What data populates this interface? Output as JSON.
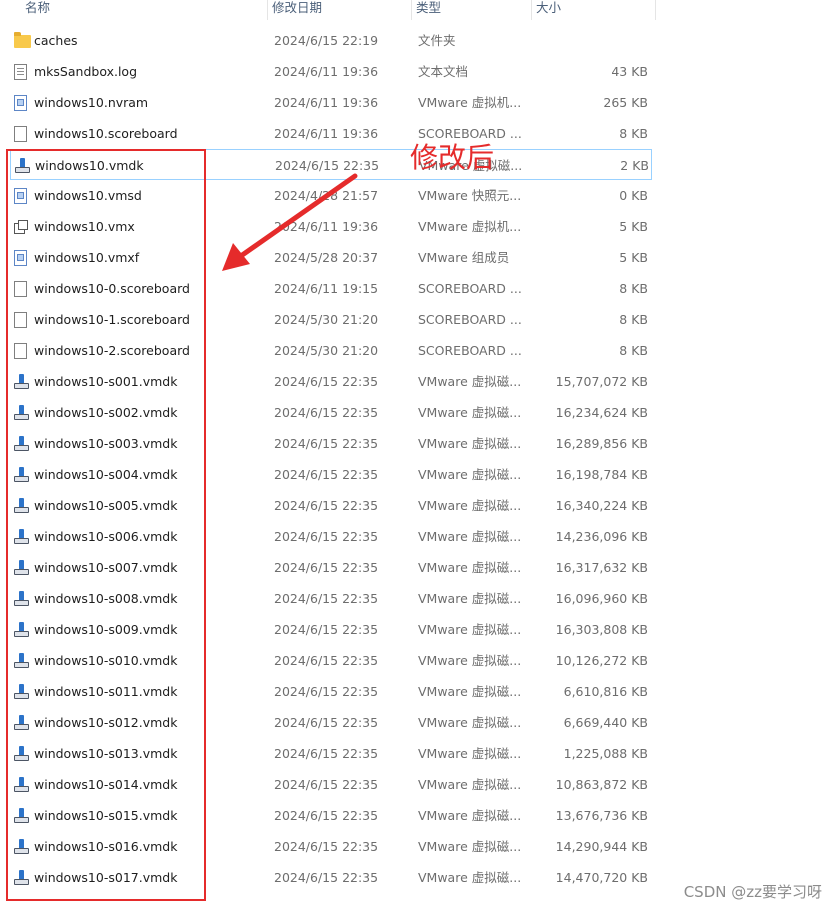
{
  "columns": {
    "name": "名称",
    "date": "修改日期",
    "type": "类型",
    "size": "大小"
  },
  "files": [
    {
      "name": "caches",
      "date": "2024/6/15 22:19",
      "type": "文件夹",
      "size": "",
      "icon": "folder-icon"
    },
    {
      "name": "mksSandbox.log",
      "date": "2024/6/11 19:36",
      "type": "文本文档",
      "size": "43 KB",
      "icon": "text-file-icon"
    },
    {
      "name": "windows10.nvram",
      "date": "2024/6/11 19:36",
      "type": "VMware 虚拟机...",
      "size": "265 KB",
      "icon": "nvram-file-icon"
    },
    {
      "name": "windows10.scoreboard",
      "date": "2024/6/11 19:36",
      "type": "SCOREBOARD ...",
      "size": "8 KB",
      "icon": "blank-file-icon"
    },
    {
      "name": "windows10.vmdk",
      "date": "2024/6/15 22:35",
      "type": "VMware 虚拟磁...",
      "size": "2 KB",
      "icon": "disk-icon",
      "selected": true
    },
    {
      "name": "windows10.vmsd",
      "date": "2024/4/28 21:57",
      "type": "VMware 快照元...",
      "size": "0 KB",
      "icon": "snapshot-file-icon"
    },
    {
      "name": "windows10.vmx",
      "date": "2024/6/11 19:36",
      "type": "VMware 虚拟机...",
      "size": "5 KB",
      "icon": "vmx-icon"
    },
    {
      "name": "windows10.vmxf",
      "date": "2024/5/28 20:37",
      "type": "VMware 组成员",
      "size": "5 KB",
      "icon": "team-file-icon"
    },
    {
      "name": "windows10-0.scoreboard",
      "date": "2024/6/11 19:15",
      "type": "SCOREBOARD ...",
      "size": "8 KB",
      "icon": "blank-file-icon"
    },
    {
      "name": "windows10-1.scoreboard",
      "date": "2024/5/30 21:20",
      "type": "SCOREBOARD ...",
      "size": "8 KB",
      "icon": "blank-file-icon"
    },
    {
      "name": "windows10-2.scoreboard",
      "date": "2024/5/30 21:20",
      "type": "SCOREBOARD ...",
      "size": "8 KB",
      "icon": "blank-file-icon"
    },
    {
      "name": "windows10-s001.vmdk",
      "date": "2024/6/15 22:35",
      "type": "VMware 虚拟磁...",
      "size": "15,707,072 KB",
      "icon": "disk-icon"
    },
    {
      "name": "windows10-s002.vmdk",
      "date": "2024/6/15 22:35",
      "type": "VMware 虚拟磁...",
      "size": "16,234,624 KB",
      "icon": "disk-icon"
    },
    {
      "name": "windows10-s003.vmdk",
      "date": "2024/6/15 22:35",
      "type": "VMware 虚拟磁...",
      "size": "16,289,856 KB",
      "icon": "disk-icon"
    },
    {
      "name": "windows10-s004.vmdk",
      "date": "2024/6/15 22:35",
      "type": "VMware 虚拟磁...",
      "size": "16,198,784 KB",
      "icon": "disk-icon"
    },
    {
      "name": "windows10-s005.vmdk",
      "date": "2024/6/15 22:35",
      "type": "VMware 虚拟磁...",
      "size": "16,340,224 KB",
      "icon": "disk-icon"
    },
    {
      "name": "windows10-s006.vmdk",
      "date": "2024/6/15 22:35",
      "type": "VMware 虚拟磁...",
      "size": "14,236,096 KB",
      "icon": "disk-icon"
    },
    {
      "name": "windows10-s007.vmdk",
      "date": "2024/6/15 22:35",
      "type": "VMware 虚拟磁...",
      "size": "16,317,632 KB",
      "icon": "disk-icon"
    },
    {
      "name": "windows10-s008.vmdk",
      "date": "2024/6/15 22:35",
      "type": "VMware 虚拟磁...",
      "size": "16,096,960 KB",
      "icon": "disk-icon"
    },
    {
      "name": "windows10-s009.vmdk",
      "date": "2024/6/15 22:35",
      "type": "VMware 虚拟磁...",
      "size": "16,303,808 KB",
      "icon": "disk-icon"
    },
    {
      "name": "windows10-s010.vmdk",
      "date": "2024/6/15 22:35",
      "type": "VMware 虚拟磁...",
      "size": "10,126,272 KB",
      "icon": "disk-icon"
    },
    {
      "name": "windows10-s011.vmdk",
      "date": "2024/6/15 22:35",
      "type": "VMware 虚拟磁...",
      "size": "6,610,816 KB",
      "icon": "disk-icon"
    },
    {
      "name": "windows10-s012.vmdk",
      "date": "2024/6/15 22:35",
      "type": "VMware 虚拟磁...",
      "size": "6,669,440 KB",
      "icon": "disk-icon"
    },
    {
      "name": "windows10-s013.vmdk",
      "date": "2024/6/15 22:35",
      "type": "VMware 虚拟磁...",
      "size": "1,225,088 KB",
      "icon": "disk-icon"
    },
    {
      "name": "windows10-s014.vmdk",
      "date": "2024/6/15 22:35",
      "type": "VMware 虚拟磁...",
      "size": "10,863,872 KB",
      "icon": "disk-icon"
    },
    {
      "name": "windows10-s015.vmdk",
      "date": "2024/6/15 22:35",
      "type": "VMware 虚拟磁...",
      "size": "13,676,736 KB",
      "icon": "disk-icon"
    },
    {
      "name": "windows10-s016.vmdk",
      "date": "2024/6/15 22:35",
      "type": "VMware 虚拟磁...",
      "size": "14,290,944 KB",
      "icon": "disk-icon"
    },
    {
      "name": "windows10-s017.vmdk",
      "date": "2024/6/15 22:35",
      "type": "VMware 虚拟磁...",
      "size": "14,470,720 KB",
      "icon": "disk-icon"
    }
  ],
  "annotation": {
    "label": "修改后",
    "color": "#e52b2b"
  },
  "watermark": "CSDN @zz要学习呀"
}
